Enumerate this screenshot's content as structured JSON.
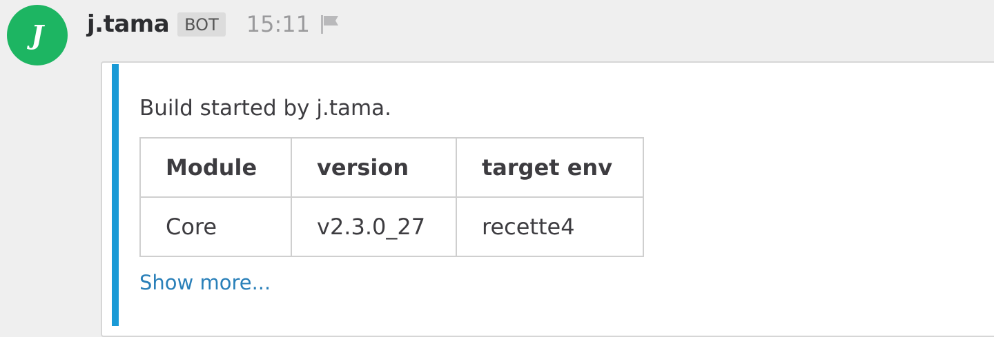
{
  "message": {
    "avatar_letter": "J",
    "username": "j.tama",
    "badge": "BOT",
    "time": "15:11",
    "icons": {
      "flag": "flag-icon"
    },
    "colors": {
      "avatar_bg": "#1db562",
      "accent_bar": "#199ad6",
      "link": "#2a80b9"
    }
  },
  "attachment": {
    "summary": "Build started by j.tama.",
    "table": {
      "headers": [
        "Module",
        "version",
        "target env"
      ],
      "rows": [
        [
          "Core",
          "v2.3.0_27",
          "recette4"
        ]
      ]
    },
    "show_more": "Show more..."
  }
}
